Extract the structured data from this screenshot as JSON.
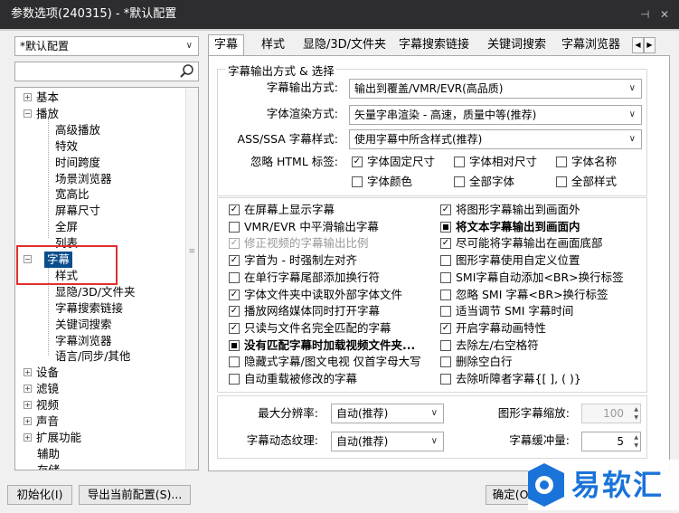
{
  "window": {
    "title": "参数选项(240315) - *默认配置",
    "pin_glyph": "⊣",
    "close_glyph": "✕"
  },
  "profile": {
    "selected": "*默认配置"
  },
  "search": {
    "placeholder": ""
  },
  "tree": [
    {
      "label": "基本",
      "expander": "+"
    },
    {
      "label": "播放",
      "expander": "−"
    },
    {
      "label": "高级播放"
    },
    {
      "label": "特效"
    },
    {
      "label": "时间跨度"
    },
    {
      "label": "场景浏览器"
    },
    {
      "label": "宽高比"
    },
    {
      "label": "屏幕尺寸"
    },
    {
      "label": "全屏"
    },
    {
      "label": "列表"
    },
    {
      "label": "字幕",
      "expander": "−"
    },
    {
      "label": "样式"
    },
    {
      "label": "显隐/3D/文件夹"
    },
    {
      "label": "字幕搜索链接"
    },
    {
      "label": "关键词搜索"
    },
    {
      "label": "字幕浏览器"
    },
    {
      "label": "语言/同步/其他"
    },
    {
      "label": "设备",
      "expander": "+"
    },
    {
      "label": "滤镜",
      "expander": "+"
    },
    {
      "label": "视频",
      "expander": "+"
    },
    {
      "label": "声音",
      "expander": "+"
    },
    {
      "label": "扩展功能",
      "expander": "+"
    },
    {
      "label": "辅助"
    },
    {
      "label": "存储"
    }
  ],
  "tabs": [
    "字幕",
    "样式",
    "显隐/3D/文件夹",
    "字幕搜索链接",
    "关键词搜索",
    "字幕浏览器"
  ],
  "output_group": {
    "title": "字幕输出方式 & 选择",
    "output_mode": {
      "label": "字幕输出方式:",
      "value": "输出到覆盖/VMR/EVR(高品质)"
    },
    "render_mode": {
      "label": "字体渲染方式:",
      "value": "矢量字串渲染 - 高速，质量中等(推荐)"
    },
    "ass_style": {
      "label": "ASS/SSA 字幕样式:",
      "value": "使用字幕中所含样式(推荐)"
    },
    "ignore_html": {
      "label": "忽略 HTML 标签:",
      "options": [
        {
          "label": "字体固定尺寸",
          "checked": true
        },
        {
          "label": "字体相对尺寸",
          "checked": false
        },
        {
          "label": "字体名称",
          "checked": false
        },
        {
          "label": "字体颜色",
          "checked": false
        },
        {
          "label": "全部字体",
          "checked": false
        },
        {
          "label": "全部样式",
          "checked": false
        }
      ]
    }
  },
  "options_left": [
    {
      "label": "在屏幕上显示字幕",
      "state": "checked"
    },
    {
      "label": "VMR/EVR 中平滑输出字幕",
      "state": "unchecked"
    },
    {
      "label": "修正视频的字幕输出比例",
      "state": "checked",
      "disabled": true
    },
    {
      "label": "字首为 - 时强制左对齐",
      "state": "checked"
    },
    {
      "label": "在单行字幕尾部添加换行符",
      "state": "unchecked"
    },
    {
      "label": "字体文件夹中读取外部字体文件",
      "state": "checked"
    },
    {
      "label": "播放网络媒体同时打开字幕",
      "state": "checked"
    },
    {
      "label": "只读与文件名完全匹配的字幕",
      "state": "checked"
    },
    {
      "label": "没有匹配字幕时加载视频文件夹...",
      "state": "indeterminate",
      "bold": true
    },
    {
      "label": "隐藏式字幕/图文电视 仅首字母大写",
      "state": "unchecked"
    },
    {
      "label": "自动重载被修改的字幕",
      "state": "unchecked"
    }
  ],
  "options_right": [
    {
      "label": "将图形字幕输出到画面外",
      "state": "checked"
    },
    {
      "label": "将文本字幕输出到画面内",
      "state": "indeterminate",
      "bold": true
    },
    {
      "label": "尽可能将字幕输出在画面底部",
      "state": "checked"
    },
    {
      "label": "图形字幕使用自定义位置",
      "state": "unchecked"
    },
    {
      "label": "SMI字幕自动添加<BR>换行标签",
      "state": "unchecked"
    },
    {
      "label": "忽略 SMI 字幕<BR>换行标签",
      "state": "unchecked"
    },
    {
      "label": "适当调节 SMI 字幕时间",
      "state": "unchecked"
    },
    {
      "label": "开启字幕动画特性",
      "state": "checked"
    },
    {
      "label": "去除左/右空格符",
      "state": "unchecked"
    },
    {
      "label": "删除空白行",
      "state": "unchecked"
    },
    {
      "label": "去除听障者字幕{[ ], ( )}",
      "state": "unchecked"
    }
  ],
  "bottom_group": {
    "max_res": {
      "label": "最大分辨率:",
      "value": "自动(推荐)"
    },
    "graphic_scale": {
      "label": "图形字幕缩放:",
      "value": "100"
    },
    "texture": {
      "label": "字幕动态纹理:",
      "value": "自动(推荐)"
    },
    "buffer": {
      "label": "字幕缓冲量:",
      "value": "5"
    }
  },
  "buttons": {
    "init": "初始化(I)",
    "export": "导出当前配置(S)...",
    "ok": "确定(O)"
  },
  "brand": {
    "logo_text": "易软汇",
    "color": "#1a73d9"
  }
}
